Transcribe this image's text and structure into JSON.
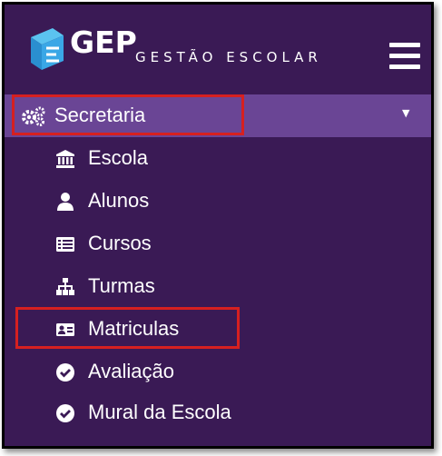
{
  "header": {
    "brand": "GEP",
    "subtitle": "GESTÃO ESCOLAR",
    "logo_icon": "gep-logo-icon",
    "menu_icon": "hamburger-menu-icon"
  },
  "sidebar": {
    "section": {
      "label": "Secretaria",
      "icon": "gears-icon",
      "caret": "▼"
    },
    "items": [
      {
        "label": "Escola",
        "icon": "bank-icon"
      },
      {
        "label": "Alunos",
        "icon": "user-icon"
      },
      {
        "label": "Cursos",
        "icon": "list-icon"
      },
      {
        "label": "Turmas",
        "icon": "sitemap-icon"
      },
      {
        "label": "Matriculas",
        "icon": "id-card-icon"
      },
      {
        "label": "Avaliação",
        "icon": "check-circle-icon"
      },
      {
        "label": "Mural da Escola",
        "icon": "check-circle-icon"
      }
    ]
  },
  "colors": {
    "background": "#3a1a55",
    "active_section": "#6a4595",
    "highlight_border": "#d62020",
    "text": "#ffffff"
  }
}
